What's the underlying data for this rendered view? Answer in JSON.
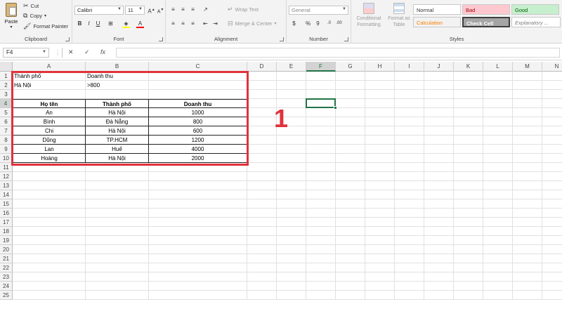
{
  "ribbon": {
    "clipboard": {
      "paste": "Paste",
      "cut": "Cut",
      "copy": "Copy",
      "format_painter": "Format Painter",
      "label": "Clipboard"
    },
    "font": {
      "name": "Calibri",
      "size": "11",
      "label": "Font",
      "bold": "B",
      "italic": "I",
      "underline": "U"
    },
    "alignment": {
      "wrap_text": "Wrap Text",
      "merge_center": "Merge & Center",
      "label": "Alignment"
    },
    "number": {
      "format": "General",
      "label": "Number",
      "currency": "$",
      "percent": "%",
      "comma": "9"
    },
    "styles": {
      "conditional_formatting": "Conditional Formatting",
      "format_as_table": "Format as Table",
      "label": "Styles",
      "cells": [
        {
          "text": "Normal",
          "bg": "#ffffff",
          "fg": "#333333"
        },
        {
          "text": "Bad",
          "bg": "#ffc7ce",
          "fg": "#9c0006"
        },
        {
          "text": "Good",
          "bg": "#c6efce",
          "fg": "#006100"
        },
        {
          "text": "Calculation",
          "bg": "#f2f2f2",
          "fg": "#fa7d00"
        },
        {
          "text": "Check Cell",
          "bg": "#a5a5a5",
          "fg": "#ffffff"
        },
        {
          "text": "Explanatory ...",
          "bg": "#ffffff",
          "fg": "#7f7f7f"
        }
      ]
    }
  },
  "formula_bar": {
    "name_box": "F4",
    "fx": "fx",
    "cancel": "✕",
    "enter": "✓",
    "value": ""
  },
  "columns": [
    "A",
    "B",
    "C",
    "D",
    "E",
    "F",
    "G",
    "H",
    "I",
    "J",
    "K",
    "L",
    "M",
    "N"
  ],
  "rows": [
    "1",
    "2",
    "3",
    "4",
    "5",
    "6",
    "7",
    "8",
    "9",
    "10",
    "11",
    "12",
    "13",
    "14",
    "15",
    "16",
    "17",
    "18",
    "19",
    "20",
    "21",
    "22",
    "23",
    "24",
    "25"
  ],
  "criteria": {
    "header": [
      "Thành phố",
      "Doanh thu"
    ],
    "values": [
      "Hà Nội",
      ">800"
    ]
  },
  "table": {
    "headers": [
      "Họ tên",
      "Thành phố",
      "Doanh thu"
    ],
    "rows": [
      [
        "An",
        "Hà Nội",
        "1000"
      ],
      [
        "Bình",
        "Đà Nẵng",
        "800"
      ],
      [
        "Chi",
        "Hà Nội",
        "600"
      ],
      [
        "Dũng",
        "TP.HCM",
        "1200"
      ],
      [
        "Lan",
        "Huế",
        "4000"
      ],
      [
        "Hoàng",
        "Hà Nội",
        "2000"
      ]
    ]
  },
  "annotation": "1",
  "colors": {
    "accent": "#217346",
    "highlight_box": "#e0323c"
  }
}
